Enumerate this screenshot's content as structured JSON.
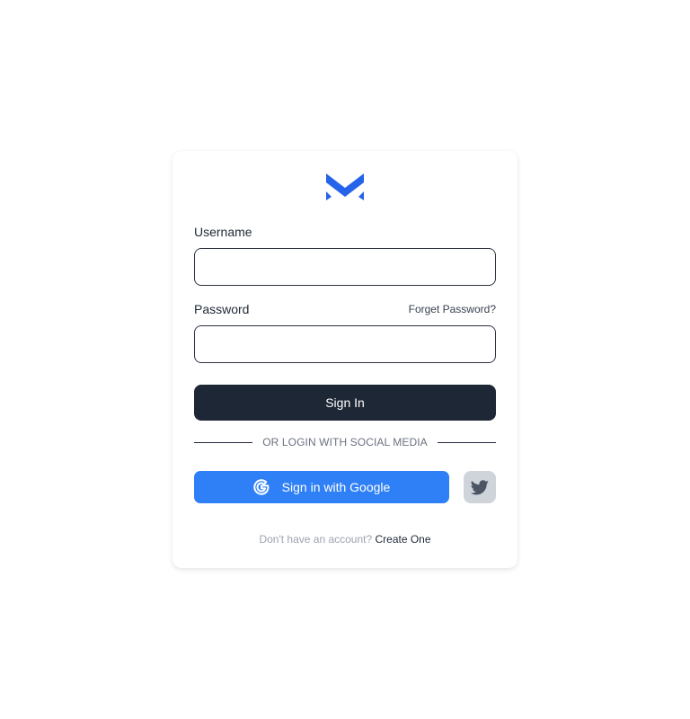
{
  "brand": {
    "logo_icon": "m-logo-icon",
    "logo_color": "#2563eb"
  },
  "form": {
    "username_label": "Username",
    "username_value": "",
    "password_label": "Password",
    "password_value": "",
    "forgot_password": "Forget Password?",
    "signin_label": "Sign In",
    "signin_color": "#1e2735"
  },
  "social": {
    "divider_text": "OR LOGIN WITH SOCIAL MEDIA",
    "google_label": "Sign in with Google",
    "google_icon": "google-icon",
    "google_color": "#2f80f6",
    "twitter_icon": "twitter-icon"
  },
  "footer": {
    "prompt": "Don't have an account?",
    "create_link": "Create One"
  }
}
